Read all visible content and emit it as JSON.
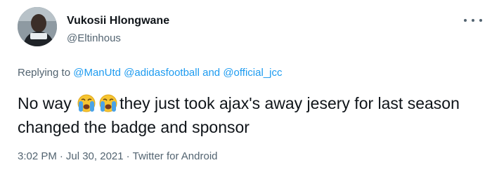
{
  "author": {
    "name": "Vukosii Hlongwane",
    "handle": "@Eltinhous"
  },
  "reply": {
    "prefix": "Replying to",
    "mention1": "@ManUtd",
    "mention2": "@adidasfootball",
    "conjunction": "and",
    "mention3": "@official_jcc"
  },
  "tweet": {
    "text_start": "No way",
    "emoji": "crying-face",
    "text_rest": "they just took ajax's away jesery for last season changed the badge and sponsor"
  },
  "meta": {
    "time": "3:02 PM",
    "date": "Jul 30, 2021",
    "source": "Twitter for Android"
  },
  "colors": {
    "link": "#1d9bf0",
    "secondary": "#536471",
    "text": "#0f1419"
  }
}
